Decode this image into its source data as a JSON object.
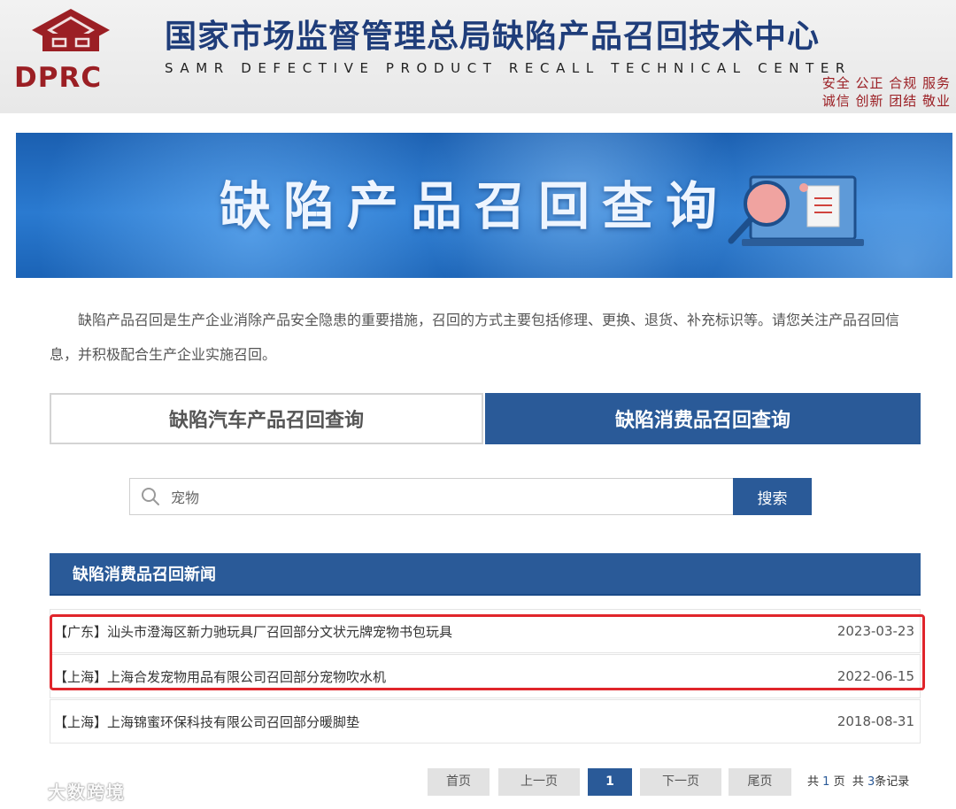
{
  "header": {
    "logo_text": "DPRC",
    "title": "国家市场监督管理总局缺陷产品召回技术中心",
    "subtitle": "SAMR DEFECTIVE PRODUCT RECALL TECHNICAL CENTER",
    "motto_line1": "安全 公正 合规 服务",
    "motto_line2": "诚信 创新 团结 敬业"
  },
  "banner": {
    "title": "缺陷产品召回查询",
    "icon": "magnifier-document-laptop-icon"
  },
  "intro": "缺陷产品召回是生产企业消除产品安全隐患的重要措施，召回的方式主要包括修理、更换、退货、补充标识等。请您关注产品召回信息，并积极配合生产企业实施召回。",
  "tabs": {
    "car": "缺陷汽车产品召回查询",
    "consumer": "缺陷消费品召回查询"
  },
  "search": {
    "value": "宠物",
    "button": "搜索",
    "icon": "search-icon"
  },
  "news": {
    "header": "缺陷消费品召回新闻",
    "items": [
      {
        "title": "【广东】汕头市澄海区新力驰玩具厂召回部分文状元牌宠物书包玩具",
        "date": "2023-03-23"
      },
      {
        "title": "【上海】上海合发宠物用品有限公司召回部分宠物吹水机",
        "date": "2022-06-15"
      },
      {
        "title": "【上海】上海锦蜜环保科技有限公司召回部分暖脚垫",
        "date": "2018-08-31"
      }
    ]
  },
  "pagination": {
    "first": "首页",
    "prev": "上一页",
    "current": "1",
    "next": "下一页",
    "last": "尾页",
    "total_prefix": "共",
    "total_pages": "1",
    "pages_suffix": "页",
    "records_prefix": "共",
    "total_records": "3",
    "records_suffix": "条记录"
  },
  "watermark": "大数跨境",
  "colors": {
    "brand_red": "#9b1f24",
    "title_blue": "#1f3d7a",
    "accent_blue": "#2a5a98",
    "highlight_red": "#e0252b"
  }
}
